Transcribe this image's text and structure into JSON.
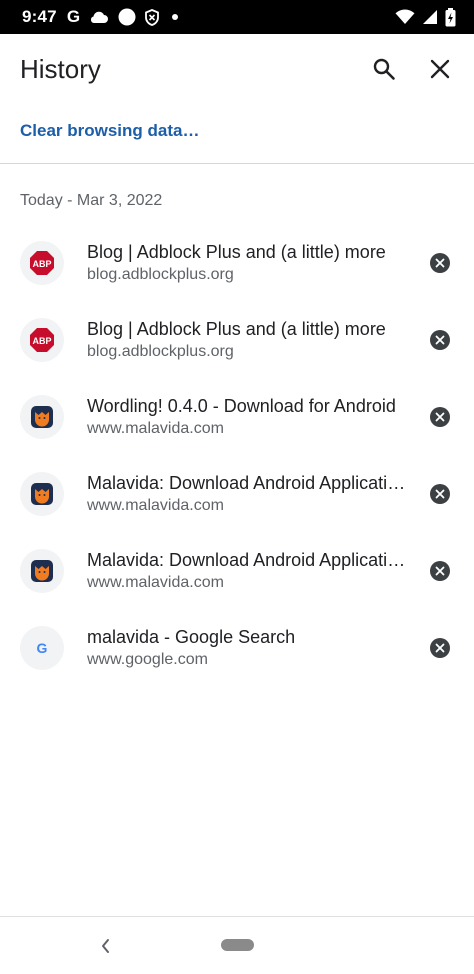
{
  "status_bar": {
    "time": "9:47",
    "left_icons": [
      "google-g-icon",
      "cloud-icon",
      "circle-icon",
      "shield-icon",
      "dot-icon"
    ],
    "right_icons": [
      "wifi-icon",
      "signal-icon",
      "battery-charging-icon"
    ]
  },
  "toolbar": {
    "title": "History",
    "search_icon": "search-icon",
    "close_icon": "close-icon"
  },
  "clear_link": "Clear browsing data…",
  "section_header": "Today - Mar 3, 2022",
  "history_items": [
    {
      "title": "Blog | Adblock Plus and (a little) more",
      "url": "blog.adblockplus.org",
      "favicon": "abp"
    },
    {
      "title": "Blog | Adblock Plus and (a little) more",
      "url": "blog.adblockplus.org",
      "favicon": "abp"
    },
    {
      "title": "Wordling! 0.4.0 - Download for Android",
      "url": "www.malavida.com",
      "favicon": "malavida"
    },
    {
      "title": "Malavida: Download Android Applications",
      "url": "www.malavida.com",
      "favicon": "malavida"
    },
    {
      "title": "Malavida: Download Android Applications",
      "url": "www.malavida.com",
      "favicon": "malavida"
    },
    {
      "title": "malavida - Google Search",
      "url": "www.google.com",
      "favicon": "google"
    }
  ],
  "favicon_text": {
    "abp": "ABP",
    "google": "G"
  },
  "colors": {
    "accent_link": "#1c5ea8",
    "abp_red": "#c70d2c",
    "malavida_orange": "#f07c21",
    "malavida_navy": "#1e2e4f"
  }
}
